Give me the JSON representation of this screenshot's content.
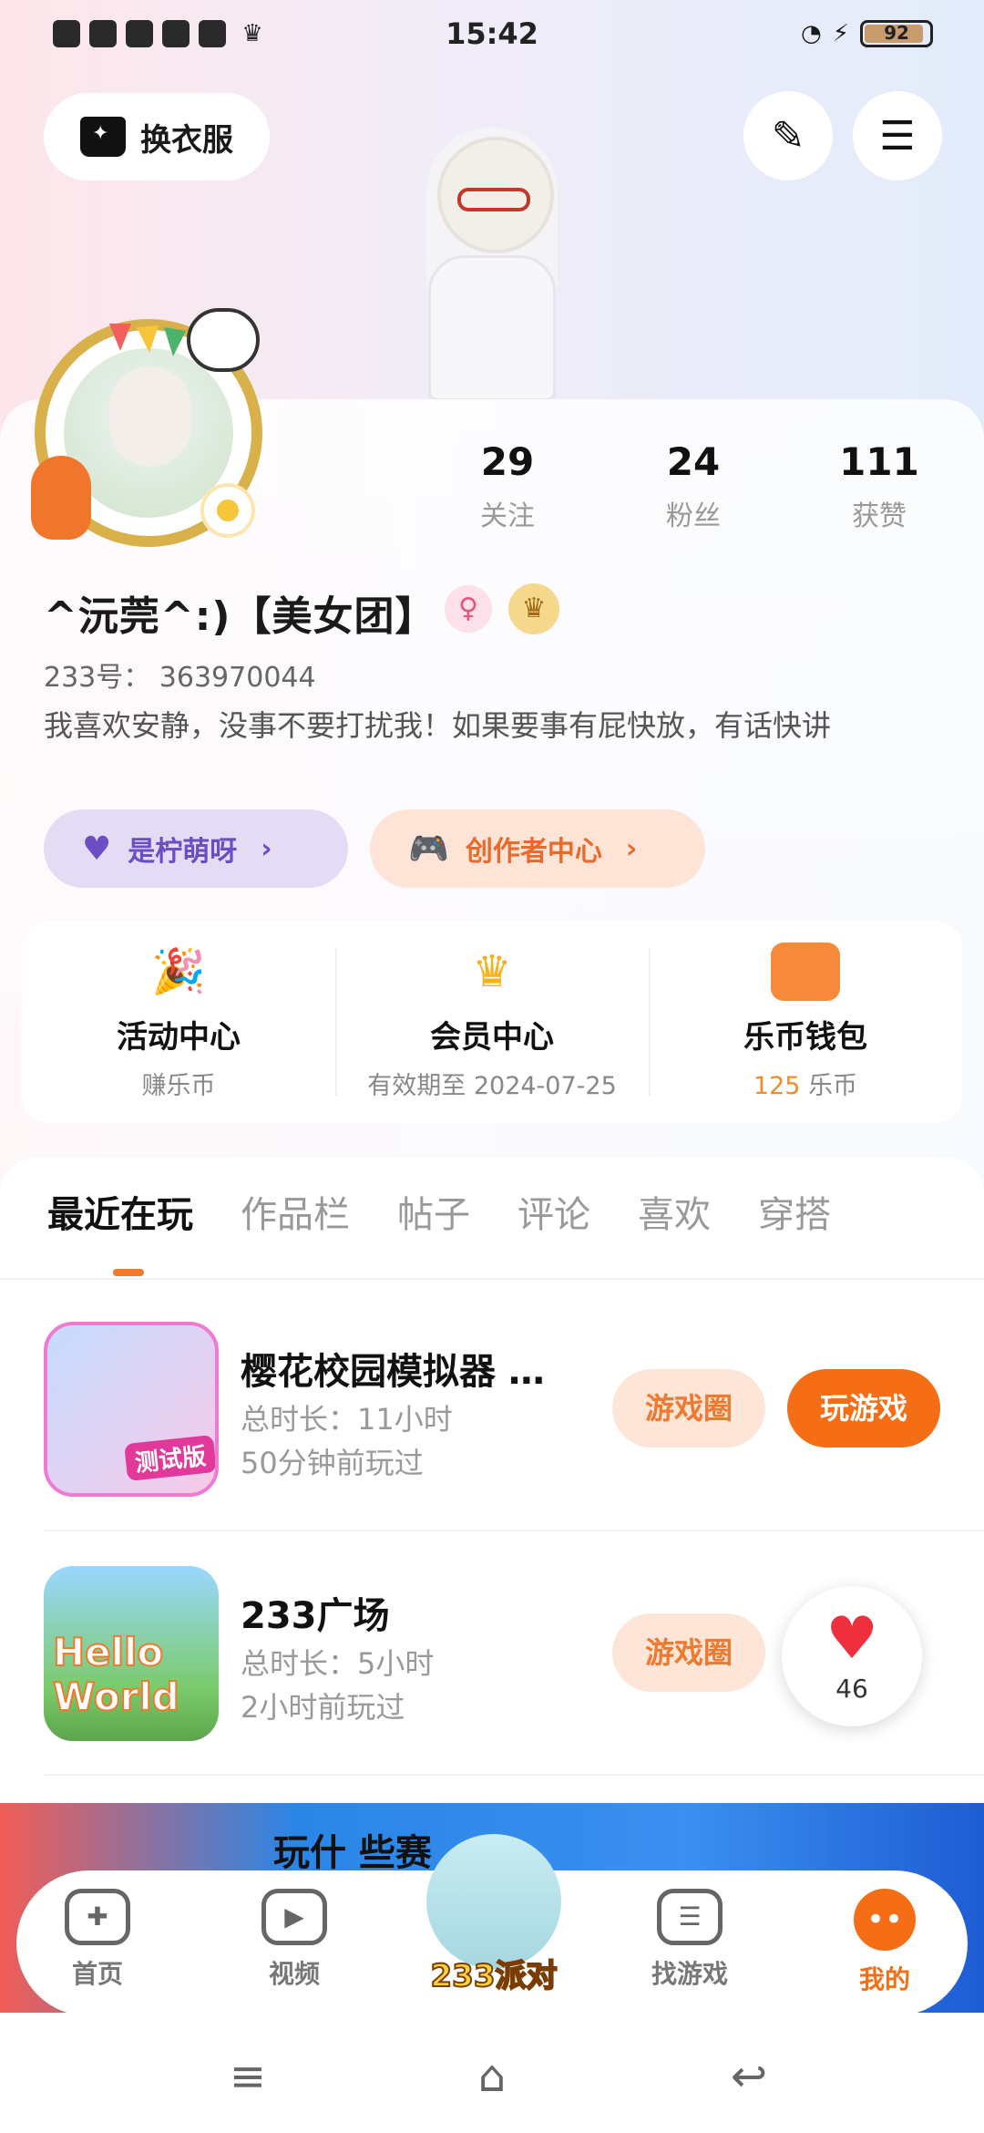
{
  "status_bar": {
    "time": "15:42",
    "battery": "92",
    "battery_level": 0.92,
    "signal": "wifi",
    "charging": "⚡"
  },
  "top": {
    "outfit_label": "换衣服",
    "edit_icon": "pen-icon",
    "menu_icon": "hamburger-icon"
  },
  "stats": {
    "follow_count": "29",
    "follow_label": "关注",
    "fans_count": "24",
    "fans_label": "粉丝",
    "likes_count": "111",
    "likes_label": "获赞"
  },
  "profile": {
    "nickname": "^沅莞^:)【美女团】",
    "uid": "233号： 363970044",
    "bio": "我喜欢安静，没事不要打扰我！如果要事有屁快放，有话快讲"
  },
  "chips": {
    "fan_label": "是柠萌呀",
    "creator_label": "创作者中心"
  },
  "quick": [
    {
      "title": "活动中心",
      "sub": "赚乐币"
    },
    {
      "title": "会员中心",
      "sub": "有效期至 2024-07-25"
    },
    {
      "title": "乐币钱包",
      "coins": "125",
      "unit": "乐币"
    }
  ],
  "tabs": [
    "最近在玩",
    "作品栏",
    "帖子",
    "评论",
    "喜欢",
    "穿搭"
  ],
  "games": [
    {
      "title": "樱花校园模拟器 …",
      "duration": "总时长：11小时",
      "last_played": "50分钟前玩过",
      "icon_tag": "测试版",
      "circle_btn": "游戏圈",
      "play_btn": "玩游戏"
    },
    {
      "title": "233广场",
      "duration": "总时长：5小时",
      "last_played": "2小时前玩过",
      "icon_tag": "Hello World",
      "circle_btn": "游戏圈"
    }
  ],
  "float_like": {
    "count": "46"
  },
  "banner": {
    "text": "玩什 些赛"
  },
  "tabbar": {
    "home": "首页",
    "video": "视频",
    "party": "233派对",
    "find": "找游戏",
    "me": "我的"
  },
  "colors": {
    "accent": "#f56d14",
    "fan_chip": "#e4dcf5",
    "creator_chip": "#fde4d6"
  }
}
